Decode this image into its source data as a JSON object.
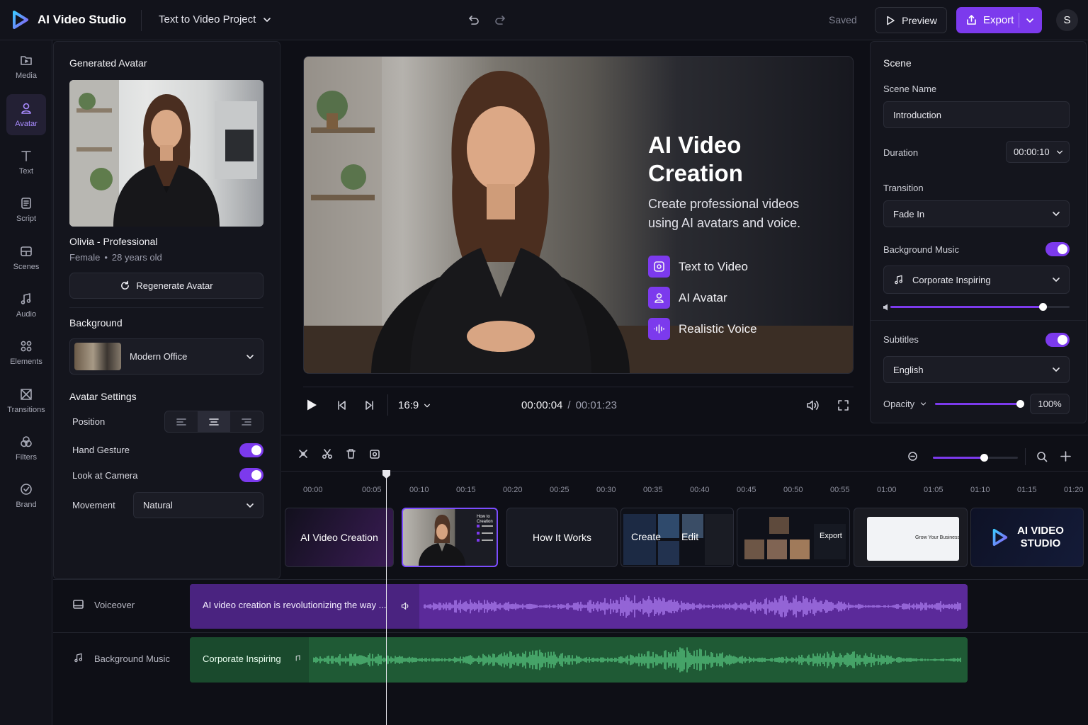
{
  "app": {
    "title": "AI Video Studio",
    "project": "Text to Video Project",
    "status": "Saved",
    "preview_label": "Preview",
    "export_label": "Export",
    "user_initial": "S",
    "accent": "#7c3aed"
  },
  "sidebar": {
    "items": [
      {
        "label": "Media",
        "icon": "media-icon"
      },
      {
        "label": "Avatar",
        "icon": "avatar-icon",
        "active": true
      },
      {
        "label": "Text",
        "icon": "text-icon"
      },
      {
        "label": "Script",
        "icon": "script-icon"
      },
      {
        "label": "Scenes",
        "icon": "scenes-icon"
      },
      {
        "label": "Audio",
        "icon": "audio-icon"
      },
      {
        "label": "Elements",
        "icon": "elements-icon"
      },
      {
        "label": "Transitions",
        "icon": "transitions-icon"
      },
      {
        "label": "Filters",
        "icon": "filters-icon"
      },
      {
        "label": "Brand",
        "icon": "brand-icon"
      }
    ]
  },
  "avatar_panel": {
    "title": "Generated Avatar",
    "name": "Olivia - Professional",
    "gender": "Female",
    "age": "28 years old",
    "regenerate_label": "Regenerate Avatar",
    "background_title": "Background",
    "background_value": "Modern Office",
    "settings_title": "Avatar Settings",
    "position_label": "Position",
    "hand_gesture_label": "Hand Gesture",
    "hand_gesture_on": true,
    "look_camera_label": "Look at Camera",
    "look_camera_on": true,
    "movement_label": "Movement",
    "movement_value": "Natural"
  },
  "preview": {
    "heading_line1": "AI Video",
    "heading_line2": "Creation",
    "sub_line1": "Create professional videos",
    "sub_line2": "using AI avatars and voice.",
    "features": [
      "Text to Video",
      "AI Avatar",
      "Realistic Voice"
    ],
    "aspect": "16:9",
    "current_time": "00:00:04",
    "separator": "/",
    "total_time": "00:01:23"
  },
  "scene_panel": {
    "title": "Scene",
    "name_label": "Scene Name",
    "name_value": "Introduction",
    "duration_label": "Duration",
    "duration_value": "00:00:10",
    "transition_label": "Transition",
    "transition_value": "Fade In",
    "music_label": "Background Music",
    "music_on": true,
    "music_value": "Corporate Inspiring",
    "music_volume": 0.85,
    "subtitles_label": "Subtitles",
    "subtitles_on": true,
    "subtitles_value": "English",
    "opacity_label": "Opacity",
    "opacity_value": "100%",
    "opacity_fraction": 1.0
  },
  "timeline": {
    "zoom_fraction": 0.6,
    "ticks": [
      "00:00",
      "00:05",
      "00:10",
      "00:15",
      "00:20",
      "00:25",
      "00:30",
      "00:35",
      "00:40",
      "00:45",
      "00:50",
      "00:55",
      "01:00",
      "01:05",
      "01:10",
      "01:15",
      "01:20"
    ],
    "clips": {
      "c1": "AI Video Creation",
      "c2": "How It Works",
      "c3a": "Create",
      "c3b": "Edit",
      "c4": "Export",
      "c5": "Grow Your Business",
      "c6_line1": "AI VIDEO",
      "c6_line2": "STUDIO"
    },
    "tracks": {
      "voiceover_label": "Voiceover",
      "voiceover_text": "AI video creation is revolutionizing the way ...",
      "music_label": "Background Music",
      "music_text": "Corporate Inspiring"
    }
  }
}
